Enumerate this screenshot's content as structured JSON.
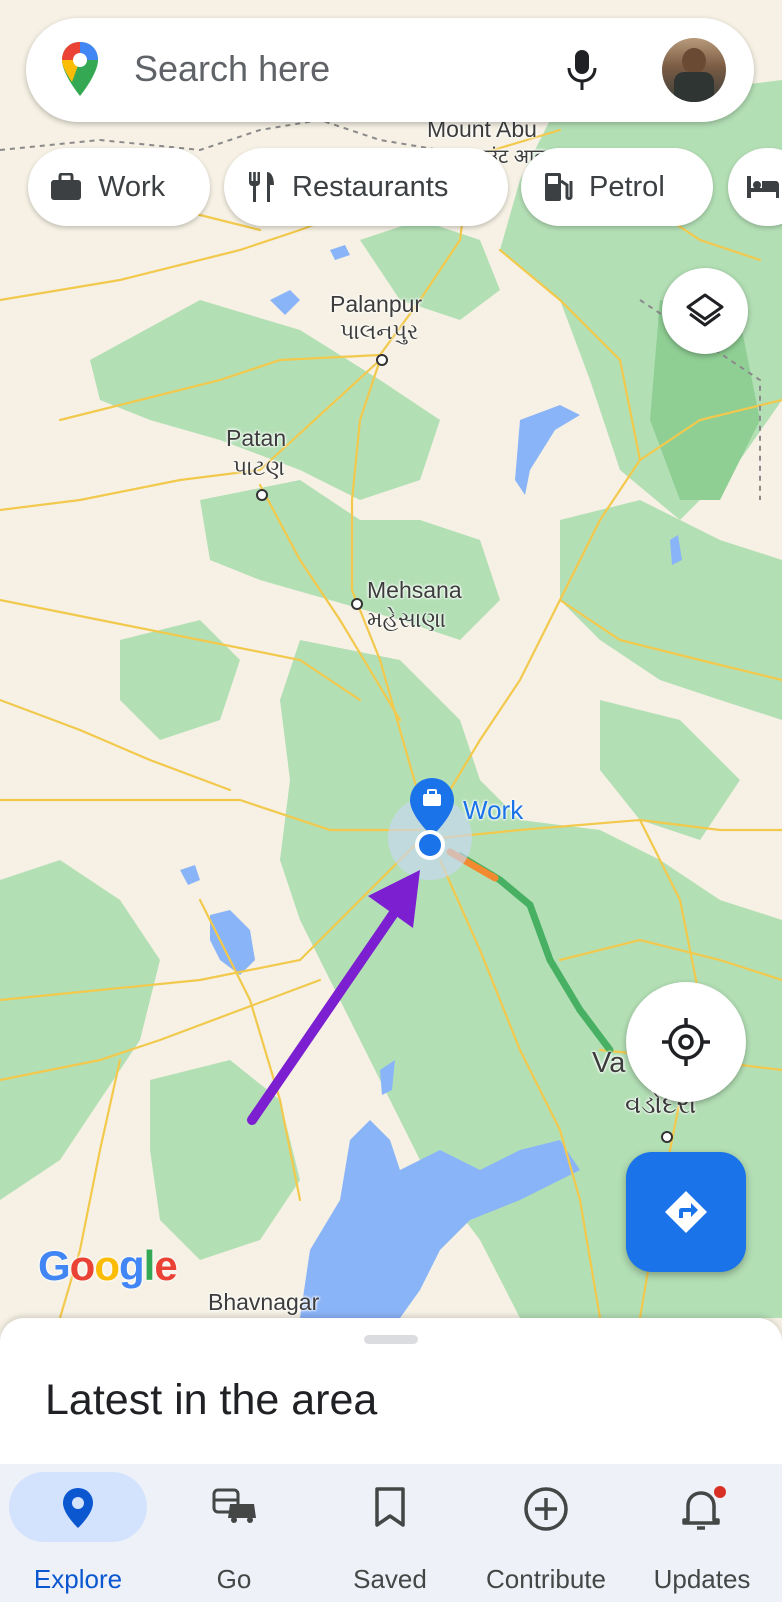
{
  "search": {
    "placeholder": "Search here"
  },
  "chips": [
    {
      "label": "Work",
      "icon": "briefcase-icon"
    },
    {
      "label": "Restaurants",
      "icon": "fork-knife-icon"
    },
    {
      "label": "Petrol",
      "icon": "fuel-pump-icon"
    },
    {
      "label": "",
      "icon": "hotel-bed-icon"
    }
  ],
  "map": {
    "labels": {
      "mount_abu": "Mount Abu",
      "mount_abu_sub": "माउंट आबू",
      "palanpur": "Palanpur",
      "palanpur_sub": "પાલનપુર",
      "patan": "Patan",
      "patan_sub": "પાટણ",
      "mehsana": "Mehsana",
      "mehsana_sub": "મહેસાણા",
      "work_pin": "Work",
      "vadodara": "Va",
      "vadodara_sub": "વડોદરા",
      "bhavnagar": "Bhavnagar",
      "google": "Google"
    },
    "colors": {
      "land": "#f6f1e4",
      "park": "#b3dfb5",
      "water": "#8ab4f8",
      "road": "#f2c94c",
      "route_green": "#4caf50",
      "route_orange": "#f28b30",
      "annotation_arrow": "#7b1fd1",
      "accent": "#1a73e8"
    }
  },
  "sheet": {
    "title": "Latest in the area"
  },
  "nav": [
    {
      "label": "Explore",
      "icon": "location-pin-icon",
      "active": true
    },
    {
      "label": "Go",
      "icon": "commute-icon",
      "active": false
    },
    {
      "label": "Saved",
      "icon": "bookmark-icon",
      "active": false
    },
    {
      "label": "Contribute",
      "icon": "add-circle-icon",
      "active": false
    },
    {
      "label": "Updates",
      "icon": "bell-icon",
      "active": false,
      "badge": true
    }
  ]
}
